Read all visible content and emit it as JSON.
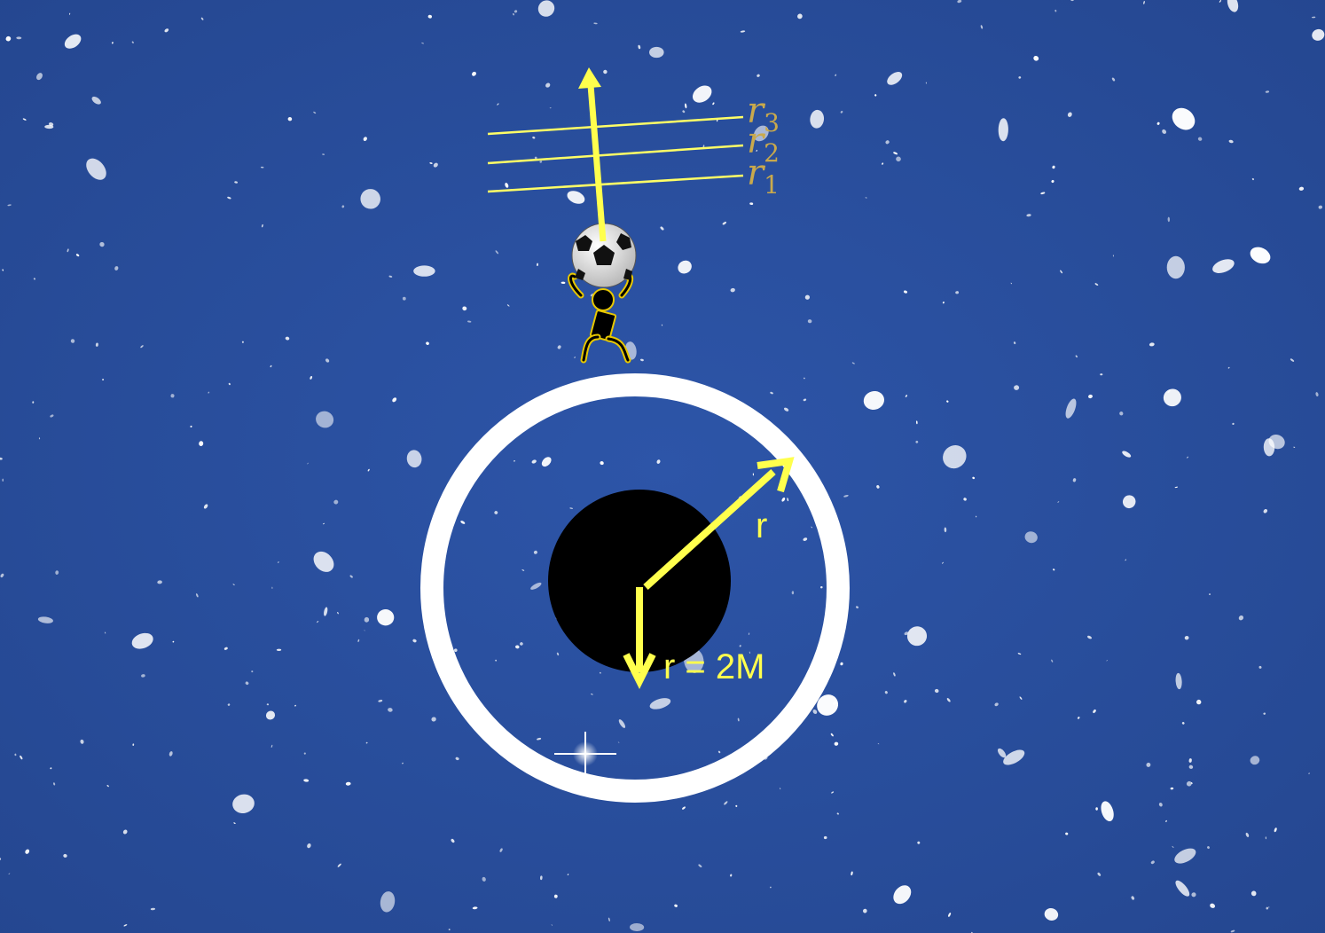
{
  "labels": {
    "radius": "r",
    "horizon": "r = 2M",
    "shells": [
      {
        "sym": "r",
        "sub": "3"
      },
      {
        "sym": "r",
        "sub": "2"
      },
      {
        "sym": "r",
        "sub": "1"
      }
    ]
  },
  "colors": {
    "sky": "#2a4f9e",
    "arrow": "#ffff4d",
    "shell_label": "#c9a94c",
    "shell_line": "#ffff66",
    "ring": "#ffffff",
    "hole": "#000000"
  },
  "icons": [
    "soccer-ball-icon",
    "stick-figure-icon"
  ]
}
